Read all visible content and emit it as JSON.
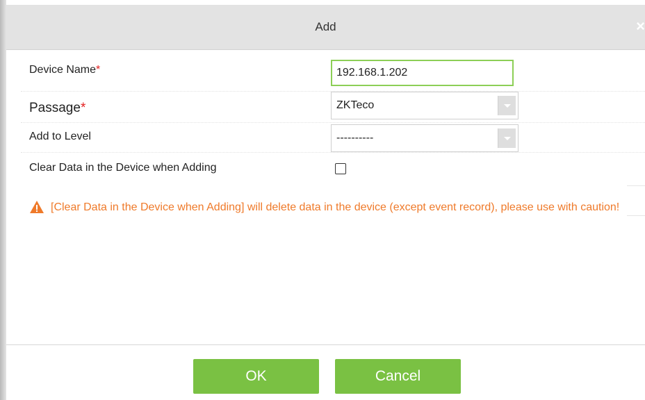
{
  "dialog": {
    "title": "Add",
    "close_glyph": "×"
  },
  "form": {
    "device_name": {
      "label": "Device Name",
      "required_mark": "*",
      "value": "192.168.1.202"
    },
    "passage": {
      "label": "Passage",
      "required_mark": "*",
      "selected": "ZKTeco"
    },
    "add_to_level": {
      "label": "Add to Level",
      "selected": "----------"
    },
    "clear_data": {
      "label": "Clear Data in the Device when Adding",
      "checked": false
    }
  },
  "warning": {
    "icon": "warning-triangle-icon",
    "text": "[Clear Data in the Device when Adding] will delete data in the device (except event record), please use with caution!"
  },
  "buttons": {
    "ok_label": "OK",
    "cancel_label": "Cancel"
  },
  "colors": {
    "accent_green": "#7ac143",
    "warning_orange": "#ef7a2a",
    "required_red": "#e32020"
  }
}
